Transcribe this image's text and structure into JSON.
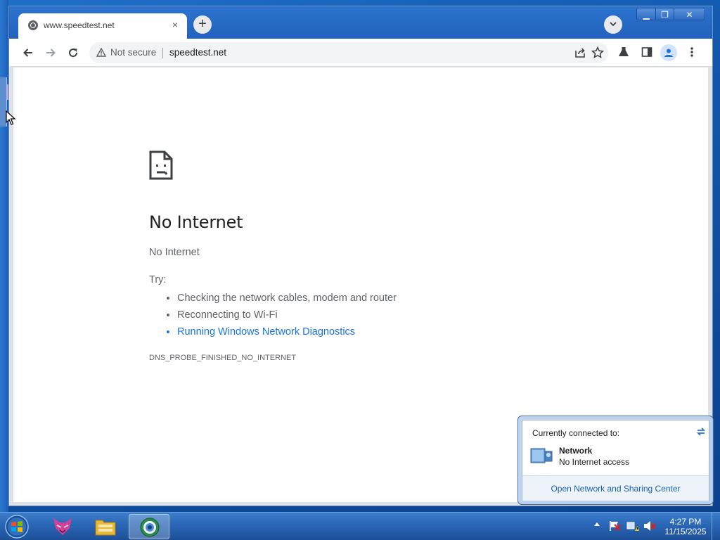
{
  "browser": {
    "tab": {
      "title": "www.speedtest.net",
      "close_glyph": "×"
    },
    "new_tab_glyph": "+",
    "window_controls": {
      "minimize": "▁",
      "maximize": "❐",
      "close": "✕"
    },
    "toolbar": {
      "security_label": "Not secure",
      "url": "speedtest.net"
    },
    "icons": [
      "back-arrow-icon",
      "forward-arrow-icon",
      "reload-icon",
      "warning-triangle-icon",
      "share-icon",
      "star-bookmark-icon",
      "labs-flask-icon",
      "side-panel-icon",
      "profile-icon",
      "menu-kebab-icon"
    ]
  },
  "error_page": {
    "heading": "No Internet",
    "subheading": "No Internet",
    "try_label": "Try:",
    "suggestions": [
      "Checking the network cables, modem and router",
      "Reconnecting to Wi-Fi",
      "Running Windows Network Diagnostics"
    ],
    "error_code": "DNS_PROBE_FINISHED_NO_INTERNET"
  },
  "network_popup": {
    "header": "Currently connected to:",
    "network_name": "Network",
    "network_status": "No Internet access",
    "link": "Open Network and Sharing Center"
  },
  "taskbar": {
    "apps": [
      "start-orb",
      "fox-app-icon",
      "file-explorer-icon",
      "browser-app-icon"
    ],
    "clock": {
      "time": "4:27 PM",
      "date": "11/15/2025"
    }
  },
  "colors": {
    "link_blue": "#1a73e8",
    "text_gray": "#5f6368",
    "taskbar_blue": "#2a66b5"
  }
}
